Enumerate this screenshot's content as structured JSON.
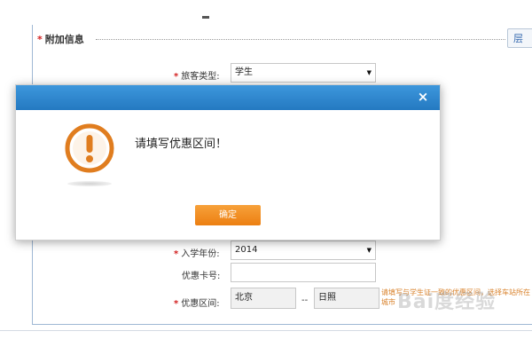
{
  "section": {
    "title": "附加信息",
    "required_mark": "*",
    "side_button_label": "层"
  },
  "form": {
    "passenger_type": {
      "label": "旅客类型:",
      "value": "学生"
    },
    "enroll_year": {
      "label": "入学年份:",
      "value": "2014"
    },
    "discount_card": {
      "label": "优惠卡号:",
      "value": ""
    },
    "discount_range": {
      "label": "优惠区间:",
      "from_value": "北京",
      "separator": "--",
      "to_value": "日照",
      "hint": "请填写与学生证一致的优惠区间，选择车站所在城市"
    }
  },
  "dialog": {
    "close_glyph": "×",
    "message": "请填写优惠区间！",
    "ok_label": "确定",
    "header_color": "#2d87d0",
    "button_color": "#f18c1f",
    "icon_color": "#e07d1f",
    "icon_name": "exclamation-circle-icon"
  },
  "watermark": {
    "text": "Bai度经验"
  }
}
